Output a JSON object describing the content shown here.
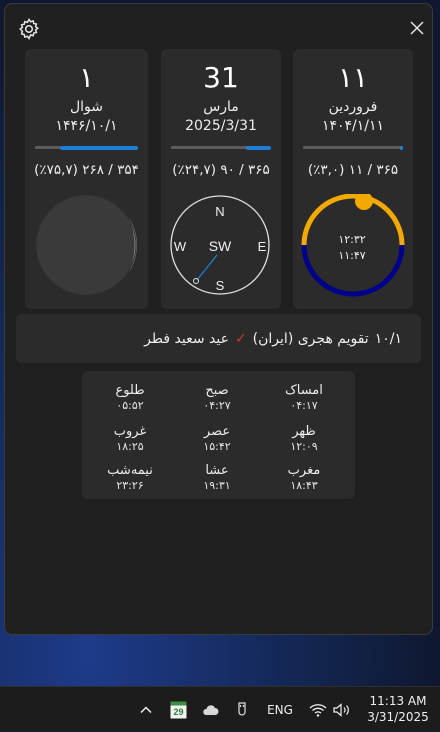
{
  "window": {
    "settings_icon": "gear-icon",
    "close_icon": "close-icon"
  },
  "cards": {
    "persian": {
      "day": "۱۱",
      "month": "فروردین",
      "date": "۱۴۰۴/۱/۱۱",
      "stats": "۳۶۵ / ۱۱ (٪۳,۰)",
      "progress": 0.03,
      "sunrise_label": "۱۲:۳۲",
      "sunset_label": "۱۱:۴۷",
      "colors": {
        "day_arc": "#f2a900",
        "night_arc": "#00008b",
        "sun": "#f2a900"
      }
    },
    "gregorian": {
      "day": "31",
      "month": "مارس",
      "date": "2025/3/31",
      "stats": "۳۶۵ / ۹۰ (٪۲۴,۷)",
      "progress": 0.247,
      "compass": {
        "n": "N",
        "e": "E",
        "s": "S",
        "w": "W",
        "direction": "SW"
      }
    },
    "hijri": {
      "day": "۱",
      "month": "شوال",
      "date": "۱۴۴۶/۱۰/۱",
      "stats": "۳۵۴ / ۲۶۸ (٪۷۵,۷)",
      "progress": 0.757,
      "moon_phase": "new-moon"
    }
  },
  "holiday": {
    "date": "۱۰/۱",
    "calendar": "تقویم هجری (ایران)",
    "check_icon": "check-icon",
    "name": "عید سعید فطر"
  },
  "prayer_times": [
    {
      "name": "امساک",
      "time": "۰۴:۱۷"
    },
    {
      "name": "صبح",
      "time": "۰۴:۲۷"
    },
    {
      "name": "طلوع",
      "time": "۰۵:۵۲"
    },
    {
      "name": "ظهر",
      "time": "۱۲:۰۹"
    },
    {
      "name": "عصر",
      "time": "۱۵:۴۲"
    },
    {
      "name": "غروب",
      "time": "۱۸:۲۵"
    },
    {
      "name": "مغرب",
      "time": "۱۸:۴۳"
    },
    {
      "name": "عشا",
      "time": "۱۹:۳۱"
    },
    {
      "name": "نیمه‌شب",
      "time": "۲۳:۲۶"
    }
  ],
  "taskbar": {
    "chevron_icon": "chevron-up-icon",
    "calendar_tray_icon": "calendar-icon",
    "calendar_tray_number": "29",
    "onedrive_icon": "cloud-icon",
    "usb_icon": "usb-icon",
    "language": "ENG",
    "wifi_icon": "wifi-icon",
    "volume_icon": "volume-icon",
    "time": "11:13 AM",
    "date": "3/31/2025"
  }
}
